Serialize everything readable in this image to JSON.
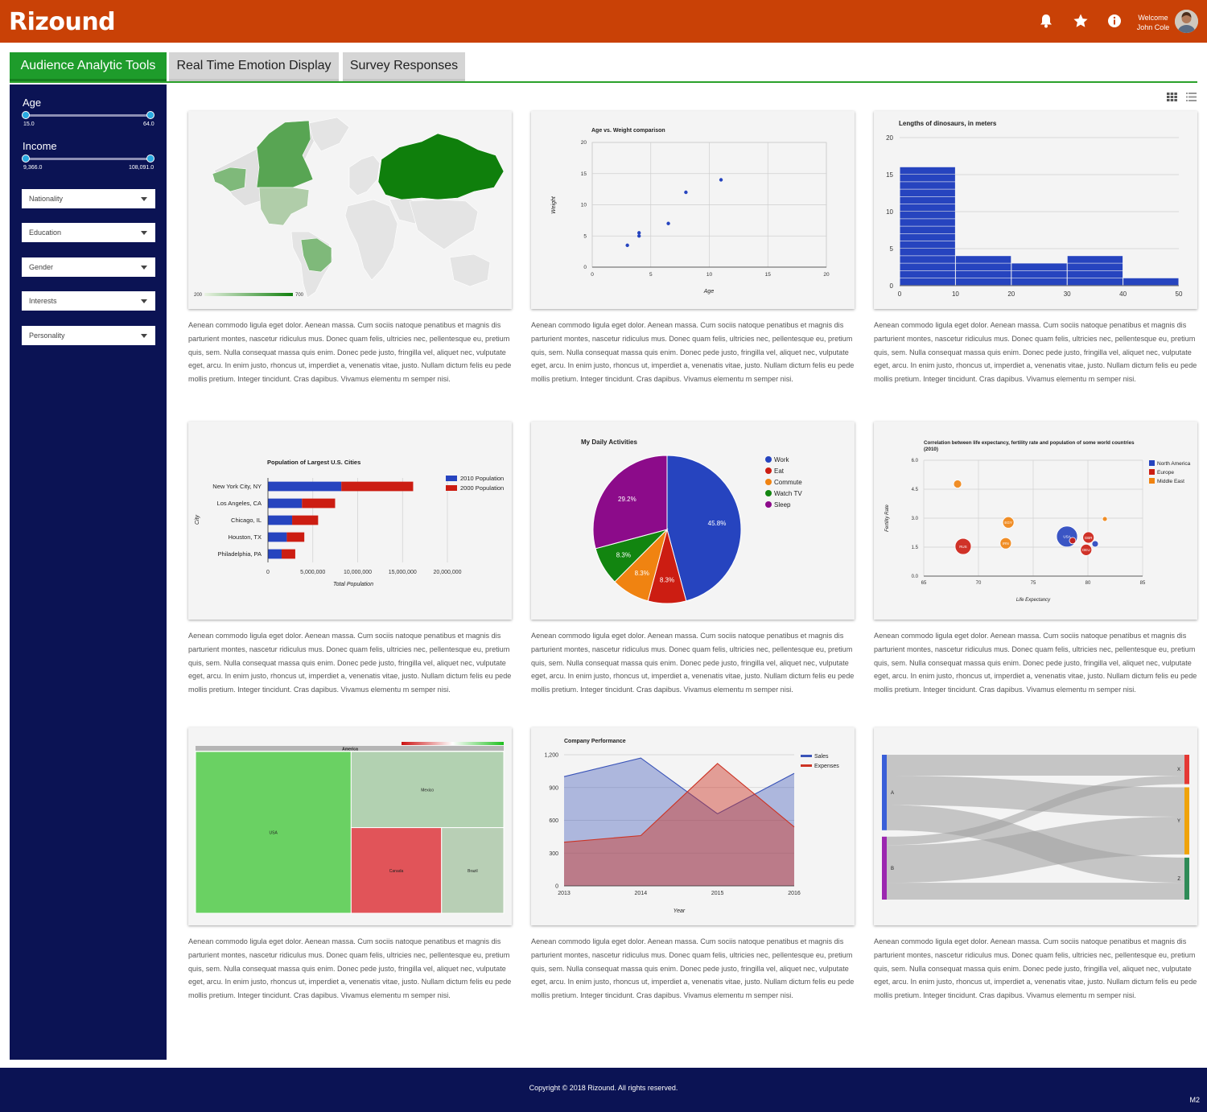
{
  "app": {
    "brand": "Rizound",
    "welcome": "Welcome",
    "user": "John Cole"
  },
  "icons": {
    "notifications": "bell-icon",
    "favorites": "star-icon",
    "info": "info-icon",
    "grid_view": "grid-view-icon",
    "list_view": "list-view-icon"
  },
  "colors": {
    "header": "#c94106",
    "sidebar": "#0b1354",
    "active_tab": "#1e9c2b",
    "inactive_tab": "#d5d5d5",
    "footer": "#0b1354"
  },
  "tabs": [
    {
      "label": "Audience Analytic Tools",
      "active": true
    },
    {
      "label": "Real Time Emotion Display",
      "active": false
    },
    {
      "label": "Survey Responses",
      "active": false
    }
  ],
  "filters": {
    "age": {
      "label": "Age",
      "min": "15.0",
      "max": "64.0"
    },
    "income": {
      "label": "Income",
      "min": "9,366.0",
      "max": "108,091.0"
    },
    "dropdowns": [
      "Nationality",
      "Education",
      "Gender",
      "Interests",
      "Personality"
    ]
  },
  "description": "Aenean commodo ligula eget dolor. Aenean massa. Cum sociis natoque penatibus et magnis dis parturient montes, nascetur ridiculus mus. Donec quam felis, ultricies nec, pellentesque eu, pretium quis, sem. Nulla consequat massa quis enim. Donec pede justo, fringilla vel, aliquet nec, vulputate eget, arcu. In enim justo, rhoncus ut, imperdiet a, venenatis vitae, justo. Nullam dictum felis eu pede mollis pretium. Integer tincidunt. Cras dapibus. Vivamus elementu m semper nisi.",
  "footer": {
    "copyright": "Copyright  ©  2018  Rizound.   All rights reserved.",
    "version": "M2"
  },
  "chart_data": [
    {
      "type": "geo",
      "legend_min": "200",
      "legend_max": "700"
    },
    {
      "type": "scatter",
      "title": "Age vs. Weight comparison",
      "xlabel": "Age",
      "ylabel": "Weight",
      "xlim": [
        0,
        20
      ],
      "ylim": [
        0,
        20
      ],
      "xticks": [
        "0",
        "5",
        "10",
        "15",
        "20"
      ],
      "yticks": [
        "0",
        "5",
        "10",
        "15",
        "20"
      ],
      "points": [
        [
          8,
          12
        ],
        [
          4,
          5.5
        ],
        [
          11,
          14
        ],
        [
          4,
          5
        ],
        [
          3,
          3.5
        ],
        [
          6.5,
          7
        ]
      ]
    },
    {
      "type": "bar",
      "title": "Lengths of dinosaurs, in meters",
      "xticks": [
        "0",
        "10",
        "20",
        "30",
        "40",
        "50"
      ],
      "yticks": [
        "0",
        "5",
        "10",
        "15",
        "20"
      ],
      "bins": [
        [
          0,
          10,
          16
        ],
        [
          10,
          20,
          4
        ],
        [
          20,
          30,
          3
        ],
        [
          30,
          40,
          4
        ],
        [
          40,
          50,
          1
        ]
      ],
      "ylim": [
        0,
        20
      ]
    },
    {
      "type": "bar",
      "orientation": "horizontal",
      "title": "Population of Largest U.S. Cities",
      "xlabel": "Total Population",
      "ylabel": "City",
      "categories": [
        "New York City, NY",
        "Los Angeles, CA",
        "Chicago, IL",
        "Houston, TX",
        "Philadelphia, PA"
      ],
      "xticks": [
        "0",
        "5,000,000",
        "10,000,000",
        "15,000,000",
        "20,000,000"
      ],
      "series": [
        {
          "name": "2010 Population",
          "color": "#2644bf",
          "values": [
            8175000,
            3792000,
            2695000,
            2099000,
            1526000
          ]
        },
        {
          "name": "2000 Population",
          "color": "#cc1d12",
          "values": [
            8008000,
            3694000,
            2896000,
            1953000,
            1517000
          ]
        }
      ]
    },
    {
      "type": "pie",
      "title": "My Daily Activities",
      "slices": [
        {
          "label": "Work",
          "value": 11,
          "display": "45.8%",
          "color": "#2644bf"
        },
        {
          "label": "Eat",
          "value": 2,
          "display": "8.3%",
          "color": "#cc1d12"
        },
        {
          "label": "Commute",
          "value": 2,
          "display": "8.3%",
          "color": "#f08311"
        },
        {
          "label": "Watch TV",
          "value": 2,
          "display": "8.3%",
          "color": "#128510"
        },
        {
          "label": "Sleep",
          "value": 7,
          "display": "29.2%",
          "color": "#8c0b8a"
        }
      ]
    },
    {
      "type": "scatter",
      "subtype": "bubble",
      "title": "Correlation between life expectancy, fertility rate and population of some world countries (2010)",
      "xlabel": "Life Expectancy",
      "ylabel": "Fertility Rate",
      "xlim": [
        65,
        85
      ],
      "ylim": [
        0,
        6
      ],
      "xticks": [
        "65",
        "70",
        "75",
        "80",
        "85"
      ],
      "yticks": [
        "0.0",
        "1.5",
        "3.0",
        "4.5",
        "6.0"
      ],
      "series": [
        {
          "name": "North America",
          "color": "#2644bf"
        },
        {
          "name": "Europe",
          "color": "#cc1d12"
        },
        {
          "name": "Middle East",
          "color": "#f08311"
        }
      ],
      "points": [
        {
          "id": "CAN",
          "x": 80.66,
          "y": 1.67,
          "region": "North America",
          "r": 4
        },
        {
          "id": "DEU",
          "x": 79.84,
          "y": 1.36,
          "region": "Europe",
          "r": 7
        },
        {
          "id": "DNK",
          "x": 78.6,
          "y": 1.84,
          "region": "Europe",
          "r": 4
        },
        {
          "id": "EGY",
          "x": 72.73,
          "y": 2.78,
          "region": "Middle East",
          "r": 7
        },
        {
          "id": "GBR",
          "x": 80.05,
          "y": 2.0,
          "region": "Europe",
          "r": 7
        },
        {
          "id": "IRN",
          "x": 72.49,
          "y": 1.7,
          "region": "Middle East",
          "r": 7
        },
        {
          "id": "IRQ",
          "x": 68.09,
          "y": 4.77,
          "region": "Middle East",
          "r": 5
        },
        {
          "id": "ISR",
          "x": 81.55,
          "y": 2.96,
          "region": "Middle East",
          "r": 3
        },
        {
          "id": "RUS",
          "x": 68.6,
          "y": 1.54,
          "region": "Europe",
          "r": 10
        },
        {
          "id": "USA",
          "x": 78.09,
          "y": 2.05,
          "region": "North America",
          "r": 13
        }
      ]
    },
    {
      "type": "treemap",
      "root": "America",
      "items": [
        {
          "label": "USA",
          "value": 52,
          "color": "#6ad163"
        },
        {
          "label": "Mexico",
          "value": 24,
          "color": "#b2d1b1"
        },
        {
          "label": "Canada",
          "value": 16,
          "color": "#e15459"
        },
        {
          "label": "Brazil",
          "value": 11,
          "color": "#b8cfb5"
        }
      ]
    },
    {
      "type": "area",
      "title": "Company Performance",
      "xlabel": "Year",
      "categories": [
        "2013",
        "2014",
        "2015",
        "2016"
      ],
      "ylim": [
        0,
        1200
      ],
      "yticks": [
        "0",
        "300",
        "600",
        "900",
        "1,200"
      ],
      "series": [
        {
          "name": "Sales",
          "color": "#3953b8",
          "values": [
            1000,
            1170,
            660,
            1030
          ]
        },
        {
          "name": "Expenses",
          "color": "#cc3324",
          "values": [
            400,
            460,
            1120,
            540
          ]
        }
      ]
    },
    {
      "type": "sankey",
      "nodes": [
        "A",
        "B",
        "X",
        "Y",
        "Z"
      ],
      "links": [
        {
          "from": "A",
          "to": "X",
          "value": 5
        },
        {
          "from": "A",
          "to": "Y",
          "value": 7
        },
        {
          "from": "A",
          "to": "Z",
          "value": 6
        },
        {
          "from": "B",
          "to": "X",
          "value": 2
        },
        {
          "from": "B",
          "to": "Y",
          "value": 9
        },
        {
          "from": "B",
          "to": "Z",
          "value": 4
        }
      ]
    }
  ]
}
